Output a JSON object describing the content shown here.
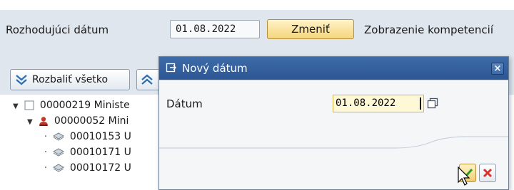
{
  "criteria": {
    "decision_date_label": "Rozhodujúci dátum",
    "decision_date_value": "01.08.2022",
    "change_button_label": "Zmeniť",
    "competence_label": "Zobrazenie kompetencií"
  },
  "toolbar": {
    "expand_all_label": "Rozbaliť všetko"
  },
  "tree": {
    "rows": [
      {
        "id": "00000219 Ministe",
        "icon": "org-unit-icon"
      },
      {
        "id": "00000052 Mini",
        "icon": "person-icon"
      },
      {
        "id": "00010153 U",
        "icon": "position-icon"
      },
      {
        "id": "00010171 U",
        "icon": "position-icon"
      },
      {
        "id": "00010172 U",
        "icon": "position-icon"
      }
    ]
  },
  "dialog": {
    "title": "Nový dátum",
    "close_glyph": "×",
    "date_label": "Dátum",
    "date_value": "01.08.2022"
  },
  "colors": {
    "title_bar": "#2c5694",
    "accent_button": "#f6d57c",
    "input_highlight": "#fff8d6",
    "cancel_red": "#d8332b",
    "ok_green": "#2f9a2a"
  }
}
